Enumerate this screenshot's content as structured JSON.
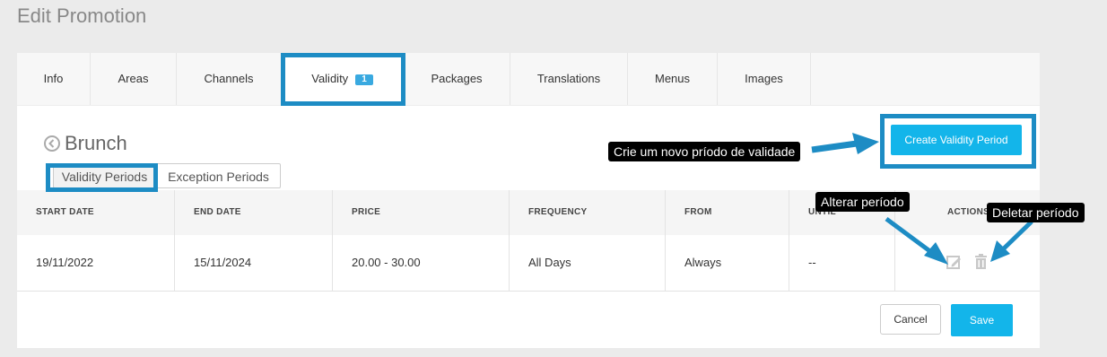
{
  "page": {
    "title": "Edit Promotion"
  },
  "tabs": [
    {
      "label": "Info"
    },
    {
      "label": "Areas"
    },
    {
      "label": "Channels"
    },
    {
      "label": "Validity",
      "badge": "1"
    },
    {
      "label": "Packages"
    },
    {
      "label": "Translations"
    },
    {
      "label": "Menus"
    },
    {
      "label": "Images"
    }
  ],
  "section": {
    "title": "Brunch"
  },
  "subtabs": [
    {
      "label": "Validity Periods"
    },
    {
      "label": "Exception Periods"
    }
  ],
  "create_button": "Create Validity Period",
  "table": {
    "headers": [
      "START DATE",
      "END DATE",
      "PRICE",
      "FREQUENCY",
      "FROM",
      "UNTIL",
      "ACTIONS"
    ],
    "rows": [
      [
        "19/11/2022",
        "15/11/2024",
        "20.00 - 30.00",
        "All Days",
        "Always",
        "--"
      ]
    ]
  },
  "footer": {
    "cancel": "Cancel",
    "save": "Save"
  },
  "annotations": {
    "create": "Crie um novo príodo de validade",
    "edit": "Alterar período",
    "delete": "Deletar período"
  },
  "colors": {
    "accent": "#13b5ea",
    "highlight": "#1d8cc4",
    "badge": "#39a9e0"
  }
}
